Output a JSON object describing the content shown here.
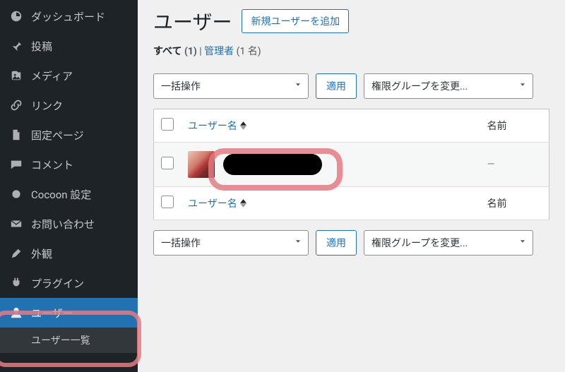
{
  "sidebar": {
    "items": [
      {
        "label": "ダッシュボード",
        "icon": "dashboard-icon"
      },
      {
        "label": "投稿",
        "icon": "pin-icon"
      },
      {
        "label": "メディア",
        "icon": "media-icon"
      },
      {
        "label": "リンク",
        "icon": "link-icon"
      },
      {
        "label": "固定ページ",
        "icon": "page-icon"
      },
      {
        "label": "コメント",
        "icon": "comment-icon"
      },
      {
        "label": "Cocoon 設定",
        "icon": "cocoon-icon"
      },
      {
        "label": "お問い合わせ",
        "icon": "mail-icon"
      },
      {
        "label": "外観",
        "icon": "appearance-icon"
      },
      {
        "label": "プラグイン",
        "icon": "plugin-icon"
      },
      {
        "label": "ユーザー",
        "icon": "user-icon",
        "active": true
      }
    ],
    "sub_item": "ユーザー一覧"
  },
  "header": {
    "title": "ユーザー",
    "add_new": "新規ユーザーを追加"
  },
  "filters": {
    "all_label": "すべて",
    "all_count": "(1)",
    "separator": " | ",
    "admin_label": "管理者",
    "admin_count": "(1 名)"
  },
  "bulk": {
    "label": "一括操作",
    "apply": "適用"
  },
  "role_change": {
    "label": "権限グループを変更..."
  },
  "table": {
    "col_username": "ユーザー名",
    "col_name": "名前",
    "row1_name": "—"
  }
}
